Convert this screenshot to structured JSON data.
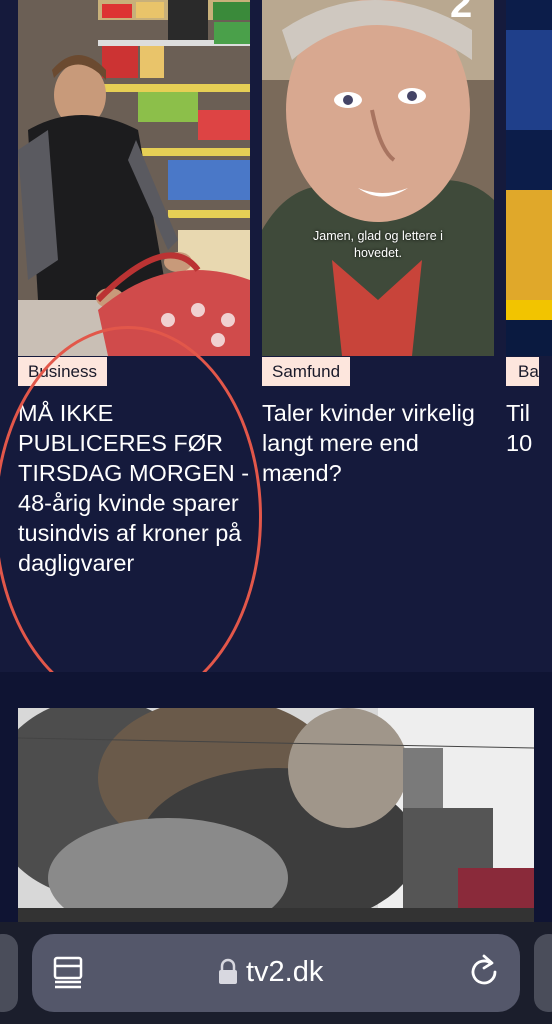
{
  "carousel": {
    "cards": [
      {
        "tag": "Business",
        "headline": "MÅ IKKE PUBLICERES FØR TIRSDAG MORGEN - 48-årig kvinde sparer tusindvis af kroner på dagligvarer",
        "image": "woman-supermarket"
      },
      {
        "tag": "Samfund",
        "headline": "Taler kvinder virkelig langt mere end mænd?",
        "image": "older-man",
        "caption": "Jamen, glad og lettere i hovedet.",
        "badge": "2"
      },
      {
        "tag": "Ba",
        "headline": "Til 10",
        "image": "sports-arena"
      }
    ]
  },
  "featured": {
    "image": "smoke-fire-building"
  },
  "browser": {
    "url": "tv2.dk",
    "icons": [
      "tabs-icon",
      "lock-icon",
      "reload-icon"
    ]
  },
  "annotation": {
    "shape": "circle",
    "color": "#e2574a"
  }
}
